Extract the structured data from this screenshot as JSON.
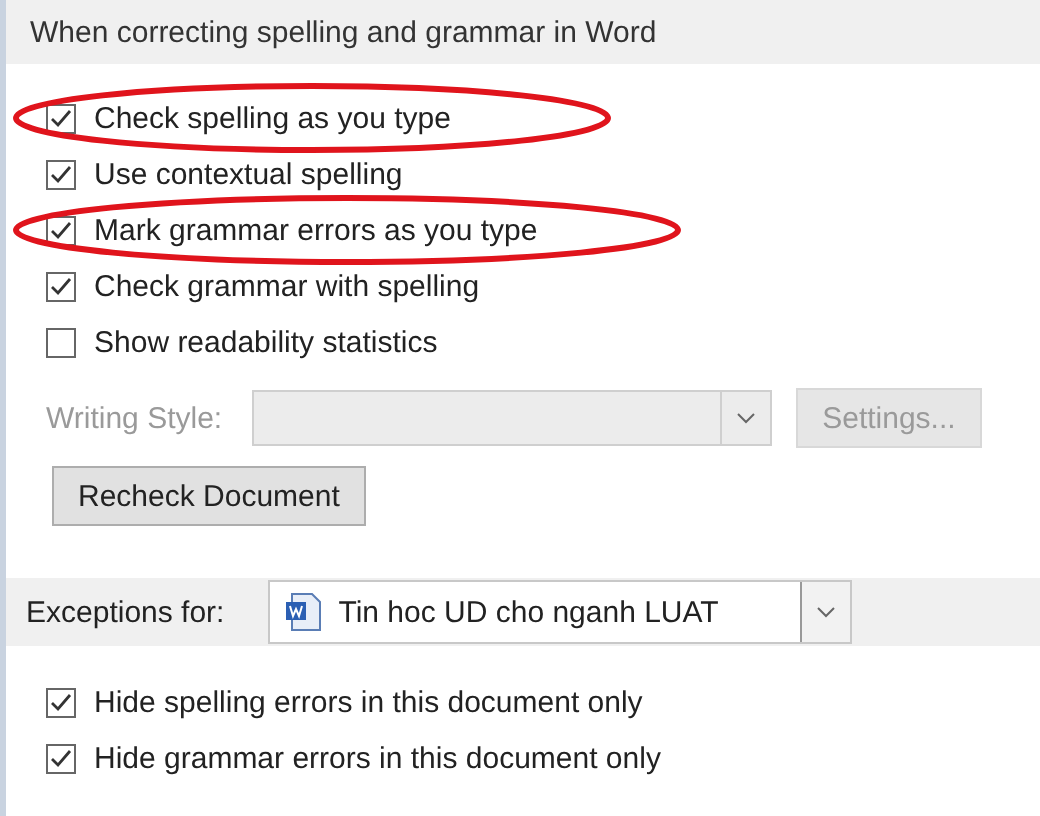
{
  "section_title": "When correcting spelling and grammar in Word",
  "options": [
    {
      "label": "Check spelling as you type",
      "checked": true,
      "highlighted": true
    },
    {
      "label": "Use contextual spelling",
      "checked": true,
      "highlighted": false
    },
    {
      "label": "Mark grammar errors as you type",
      "checked": true,
      "highlighted": true
    },
    {
      "label": "Check grammar with spelling",
      "checked": true,
      "highlighted": false
    },
    {
      "label": "Show readability statistics",
      "checked": false,
      "highlighted": false
    }
  ],
  "writing_style": {
    "label": "Writing Style:",
    "disabled": true
  },
  "settings_button": {
    "label": "Settings...",
    "disabled": true
  },
  "recheck_button": "Recheck Document",
  "exceptions": {
    "label": "Exceptions for:",
    "document": "Tin hoc UD cho nganh LUAT"
  },
  "exception_options": [
    {
      "label": "Hide spelling errors in this document only",
      "checked": true
    },
    {
      "label": "Hide grammar errors in this document only",
      "checked": true
    }
  ]
}
